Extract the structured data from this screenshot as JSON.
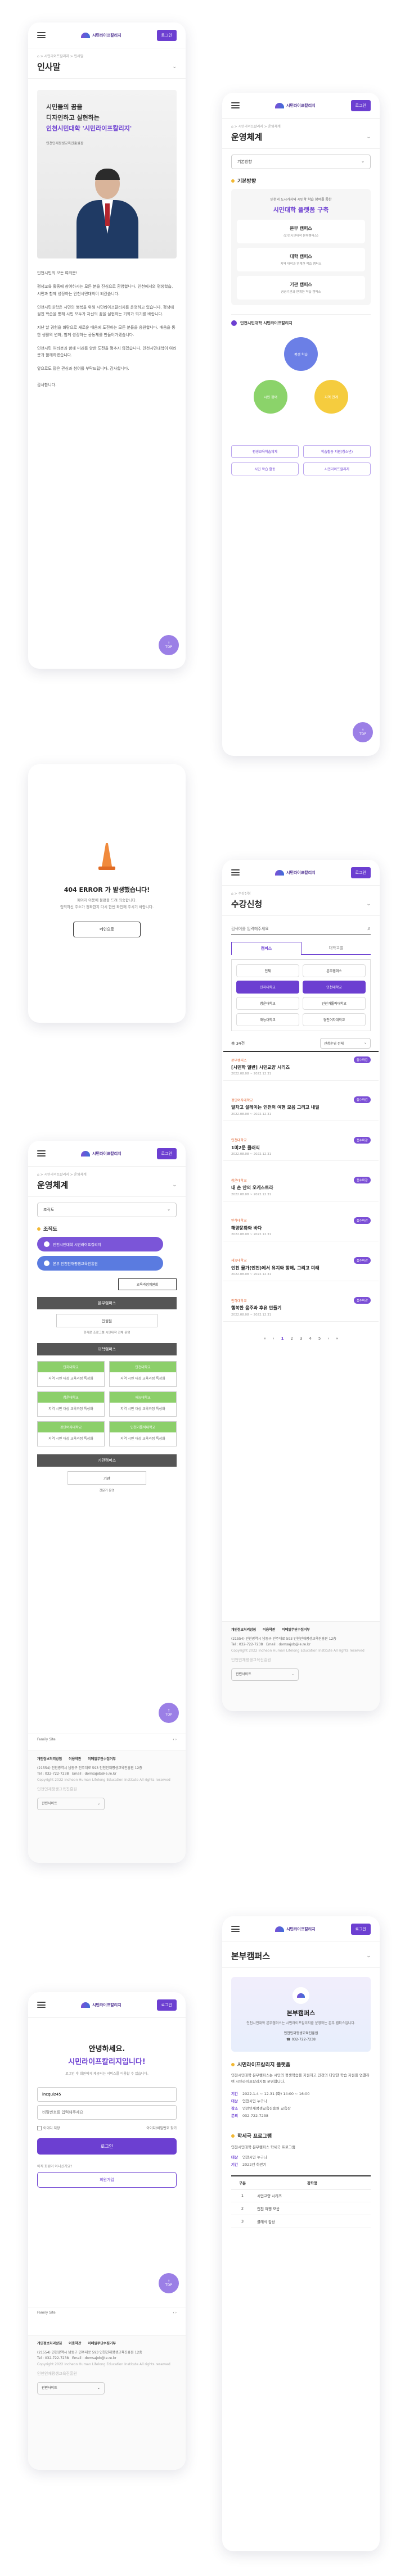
{
  "header": {
    "logo_text": "시민라이프칼리지",
    "login_label": "로그인"
  },
  "greeting": {
    "breadcrumb": "⌂ > 시민라이프칼리지 > 인사말",
    "title": "인사말",
    "hero_line1": "시민들의 꿈을",
    "hero_line2": "디자인하고 실현하는",
    "hero_line3": "인천시민대학 '시민라이프칼리지'",
    "hero_sign": "인천인재평생교육진흥원장",
    "paragraphs": [
      "인천시민의 모든 여러분!",
      "평생교육 활동에 참여하시는 모든 분을 진심으로 환영합니다. 인천에서의 평생학습, 시민과 함께 성장하는 인천시민대학이 되겠습니다.",
      "인천시민대학은 시민의 행복을 위해 시민라이프칼리지를 운영하고 있습니다. 평생에 걸친 학습을 통해 시민 모두가 자신의 꿈을 실현하는 기회가 되기를 바랍니다.",
      "지난 날 경험을 바탕으로 새로운 배움에 도전하는 모든 분들을 응원합니다. 배움을 통한 생활의 변화, 함께 성장하는 공동체를 만들어가겠습니다.",
      "인천시민 여러분과 함께 미래를 향한 도전을 멈추지 않겠습니다. 인천시민대학이 여러분과 함께하겠습니다.",
      "앞으로도 많은 관심과 참여를 부탁드립니다. 감사합니다."
    ],
    "closing": "감사합니다."
  },
  "ops": {
    "breadcrumb": "⌂ > 시민라이프칼리지 > 운영체계",
    "title": "운영체계",
    "select_value": "기본방향",
    "section": "기본방향",
    "vision_small": "인천의 도시가치와 시민학 학습 참여를 통한",
    "vision_big": "시민대학 플랫폼 구축",
    "blocks": [
      {
        "t": "본부 캠퍼스",
        "d": "(인천시민대학 본부캠퍼스)"
      },
      {
        "t": "대학 캠퍼스",
        "d": "지역 대학과 연계한 학습 캠퍼스"
      },
      {
        "t": "기관 캠퍼스",
        "d": "공공기관과 연계한 학습 캠퍼스"
      }
    ],
    "center": "인천시민대학 시민라이프칼리지",
    "circles": [
      "평생 학습",
      "시민 참여",
      "지역 연계"
    ],
    "tags": [
      "평생교육학습체계",
      "학습활동 지원(청소년)",
      "시민 학습 활동",
      "시민라이프칼리지"
    ],
    "top_label": "TOP"
  },
  "error": {
    "title": "404 ERROR 가 발생했습니다!",
    "desc1": "페이지 이용에 불편을 드려 죄송합니다.",
    "desc2": "입력하신 주소가 정확한지 다시 한번 확인해 주시기 바랍니다.",
    "home": "메인으로"
  },
  "courses": {
    "breadcrumb": "⌂ > 수강신청",
    "title": "수강신청",
    "search_placeholder": "검색어를 입력해주세요",
    "tabs": [
      "캠퍼스",
      "대학교별"
    ],
    "filters": [
      "전체",
      "본부캠퍼스",
      "인하대학교",
      "인천대학교",
      "청운대학교",
      "인천가톨릭대학교",
      "재능대학교",
      "경인여자대학교"
    ],
    "count": "총 34건",
    "sort": "신청순위 전체",
    "list": [
      {
        "camp": "본부캠퍼스",
        "badge": "접수마감",
        "title": "[시민학 일반] 시민교양 시리즈",
        "date": "2022.08.08 ~ 2022.12.31"
      },
      {
        "camp": "경인여자대학교",
        "badge": "접수마감",
        "title": "알차고 설레이는 인천의 여행 모음 그리고 내일",
        "date": "2022.08.08 ~ 2022.12.31"
      },
      {
        "camp": "인천대학교",
        "badge": "접수마감",
        "title": "1미2문 클래식",
        "date": "2022.08.08 ~ 2022.12.31"
      },
      {
        "camp": "청운대학교",
        "badge": "접수마감",
        "title": "내 손 안의 오케스트라",
        "date": "2022.08.08 ~ 2022.12.31"
      },
      {
        "camp": "인하대학교",
        "badge": "접수마감",
        "title": "해양문화와 바다",
        "date": "2022.08.08 ~ 2022.12.31"
      },
      {
        "camp": "재능대학교",
        "badge": "접수마감",
        "title": "인천 물가(인천)에서 유지와 항해, 그리고 미래",
        "date": "2022.08.08 ~ 2022.12.31"
      },
      {
        "camp": "인하대학교",
        "badge": "접수마감",
        "title": "행복한 음주과 후유 만들기",
        "date": "2022.08.08 ~ 2022.12.31"
      }
    ],
    "pages": [
      "1",
      "2",
      "3",
      "4",
      "5"
    ]
  },
  "org": {
    "breadcrumb": "⌂ > 시민라이프칼리지 > 운영체계",
    "title": "운영체계",
    "select_value": "조직도",
    "section": "조직도",
    "pills": [
      "인천시민대학 시민라이프칼리지",
      "본부 인천인재평생교육진흥원"
    ],
    "committee": "교육과정위원회",
    "head": "본부캠퍼스",
    "head_desc": "인원팀",
    "head_note": "현재로 조로그램 시민대학 전체 운영",
    "univ": "대학캠퍼스",
    "univ_boxes": [
      "인하대학교",
      "인천대학교",
      "청운대학교",
      "재능대학교",
      "경인여자대학교",
      "인천가톨릭대학교"
    ],
    "univ_note": "지역 시민 대상 교육과정 특성화",
    "inst": "기관캠퍼스",
    "inst_box": "기관",
    "inst_note": "전문가 운영",
    "family": "Family Site"
  },
  "footer": {
    "links": [
      "개인정보처리방침",
      "이용약관",
      "이메일무단수집거부"
    ],
    "address": "(21554) 인천광역시 남동구 인주대로 593 인천인재평생교육진흥원 12층",
    "tel": "Tel : 032-722-7238",
    "email": "Email : domsajob@ie.re.kr",
    "copy": "Copyright 2022 Incheon Human Lifelong Education Institute All rights reserved",
    "logo": "인천인재평생교육진흥원",
    "family": "관련사이트"
  },
  "login": {
    "title1": "안녕하세요.",
    "title2": "시민라이프칼리지입니다!",
    "desc": "로그인 후 회원에게 제공되는 서비스를 이용할 수 있습니다.",
    "id_value": "incquiz45",
    "pw_placeholder": "비밀번호를 입력해주세요",
    "save_id": "아이디 저장",
    "find": "아이디/비밀번호 찾기",
    "login_btn": "로그인",
    "join_q": "아직 회원이 아니신가요?",
    "join_btn": "회원가입"
  },
  "campus": {
    "title": "본부캠퍼스",
    "hero_title": "본부캠퍼스",
    "hero_desc": "인천시민대학 본부캠퍼스는 시민라이프칼리지를 운영하는 본부 캠퍼스입니다.",
    "hero_addr": "인천인재평생교육진흥원",
    "hero_tel": "032-722-7238",
    "sec1": "시민라이프칼리지 플랫폼",
    "desc": "인천시민대학 본부캠퍼스는 시민의 평생학습을 지원하고 인천의 다양한 학습 자원을 연결하여 시민라이프칼리지를 운영합니다.",
    "info": [
      {
        "k": "기간",
        "v": "2022.1.4 ~ 12.31 (화) 14:00 ~ 16:00"
      },
      {
        "k": "대상",
        "v": "인천시민 누구나"
      },
      {
        "k": "장소",
        "v": "인천인재평생교육진흥원 교육장"
      },
      {
        "k": "문의",
        "v": "032-722-7238"
      }
    ],
    "sec2": "학세국 프로그램",
    "prog_desc": "인천시민대학 본부캠퍼스 학세국 프로그램",
    "prog_info": [
      {
        "k": "대상",
        "v": "인천시민 누구나"
      },
      {
        "k": "기간",
        "v": "2022년 하반기"
      }
    ],
    "table_head": [
      "구분",
      "강좌명"
    ],
    "table_rows": [
      [
        "1",
        "시민교양 시리즈"
      ],
      [
        "2",
        "인천 여행 모음"
      ],
      [
        "3",
        "클래식 감상"
      ]
    ]
  }
}
